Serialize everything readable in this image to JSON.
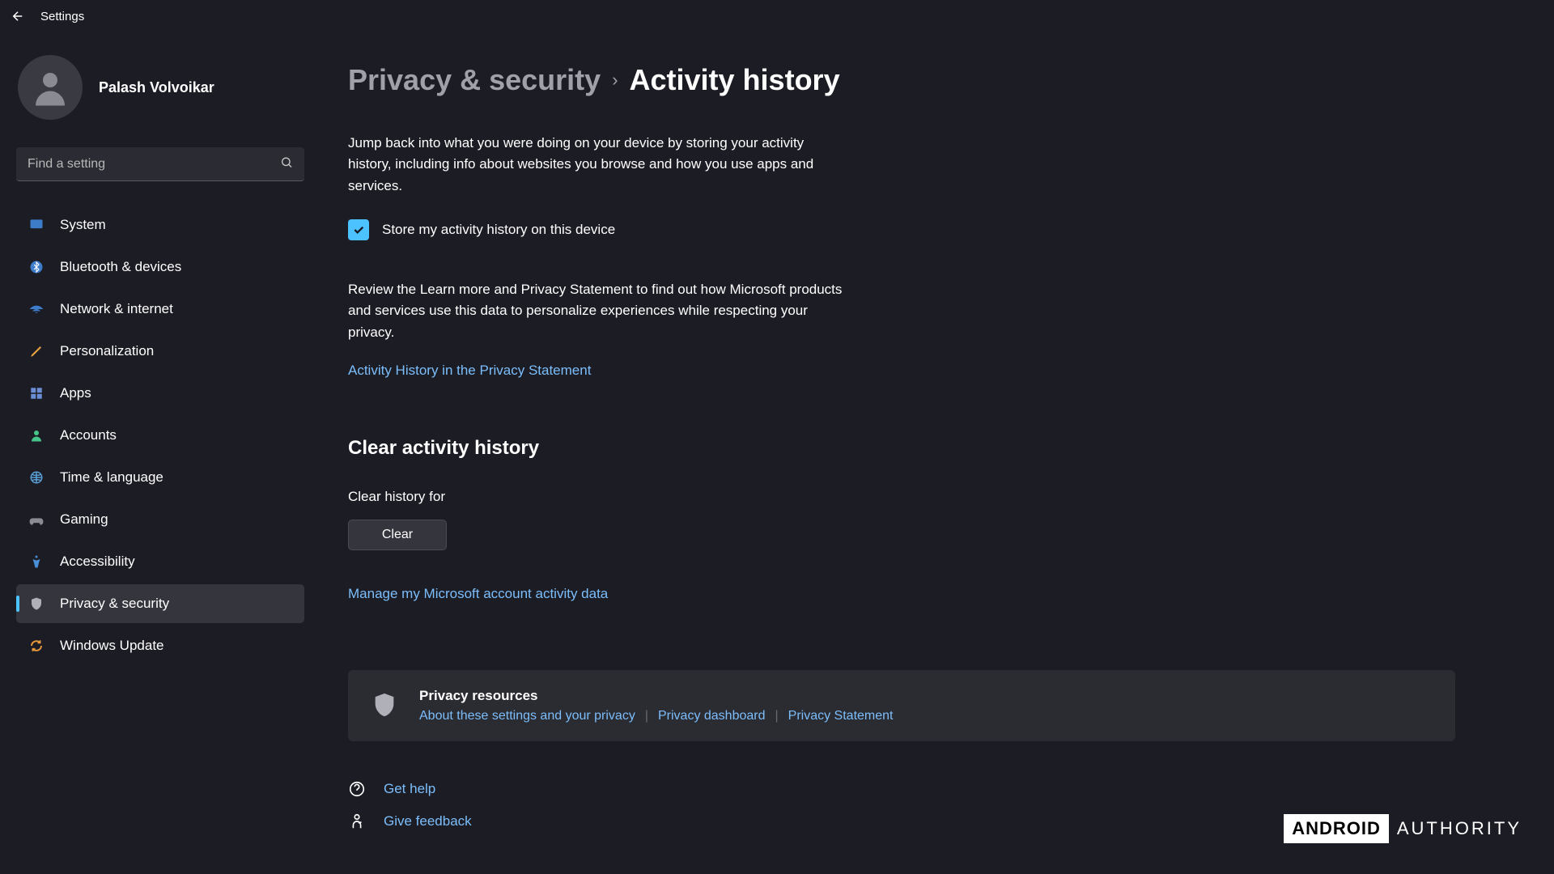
{
  "window": {
    "title": "Settings"
  },
  "user": {
    "name": "Palash Volvoikar"
  },
  "search": {
    "placeholder": "Find a setting"
  },
  "nav": [
    {
      "label": "System"
    },
    {
      "label": "Bluetooth & devices"
    },
    {
      "label": "Network & internet"
    },
    {
      "label": "Personalization"
    },
    {
      "label": "Apps"
    },
    {
      "label": "Accounts"
    },
    {
      "label": "Time & language"
    },
    {
      "label": "Gaming"
    },
    {
      "label": "Accessibility"
    },
    {
      "label": "Privacy & security"
    },
    {
      "label": "Windows Update"
    }
  ],
  "breadcrumb": {
    "parent": "Privacy & security",
    "current": "Activity history"
  },
  "content": {
    "intro": "Jump back into what you were doing on your device by storing your activity history, including info about websites you browse and how you use apps and services.",
    "checkbox_label": "Store my activity history on this device",
    "review": "Review the Learn more and Privacy Statement to find out how Microsoft products and services use this data to personalize experiences while respecting your privacy.",
    "privacy_link": "Activity History in the Privacy Statement",
    "section_title": "Clear activity history",
    "clear_label": "Clear history for",
    "clear_button": "Clear",
    "manage_link": "Manage my Microsoft account activity data"
  },
  "card": {
    "title": "Privacy resources",
    "links": [
      "About these settings and your privacy",
      "Privacy dashboard",
      "Privacy Statement"
    ]
  },
  "bottom": {
    "help": "Get help",
    "feedback": "Give feedback"
  },
  "watermark": {
    "box": "ANDROID",
    "text": "AUTHORITY"
  }
}
